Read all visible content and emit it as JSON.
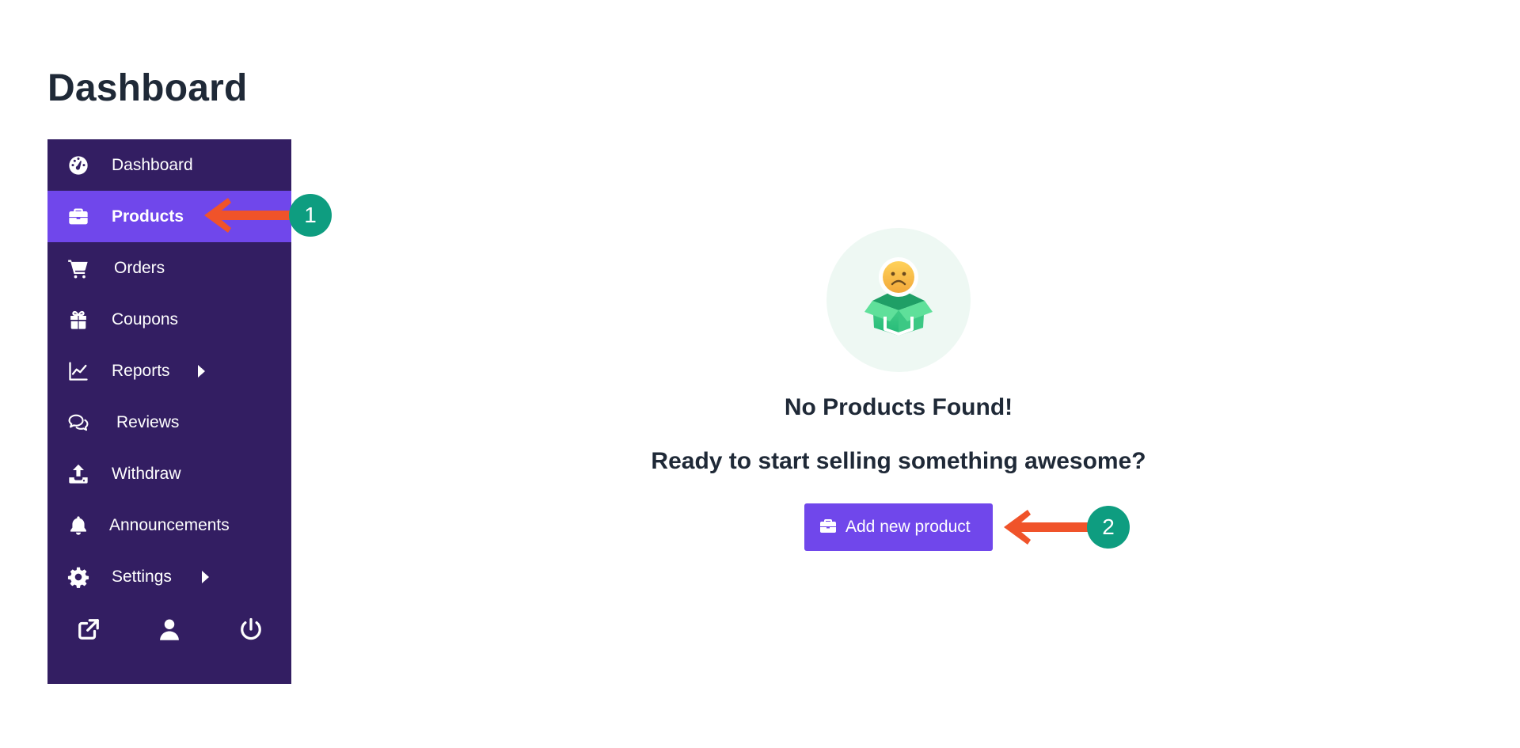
{
  "page": {
    "title": "Dashboard"
  },
  "sidebar": {
    "items": [
      {
        "label": "Dashboard",
        "icon": "tachometer-icon"
      },
      {
        "label": "Products",
        "icon": "briefcase-icon",
        "active": true
      },
      {
        "label": "Orders",
        "icon": "cart-icon"
      },
      {
        "label": "Coupons",
        "icon": "gift-icon"
      },
      {
        "label": "Reports",
        "icon": "line-chart-icon",
        "submenu": true
      },
      {
        "label": "Reviews",
        "icon": "comments-icon"
      },
      {
        "label": "Withdraw",
        "icon": "upload-icon"
      },
      {
        "label": "Announcements",
        "icon": "bell-icon"
      },
      {
        "label": "Settings",
        "icon": "gear-icon",
        "submenu": true
      }
    ],
    "footer": [
      {
        "icon": "external-link-icon"
      },
      {
        "icon": "user-icon"
      },
      {
        "icon": "power-icon"
      }
    ]
  },
  "empty_state": {
    "illustration": "empty-box-sad-face-icon",
    "title": "No Products Found!",
    "subtitle": "Ready to start selling something awesome?",
    "button_label": "Add new product",
    "button_icon": "briefcase-icon"
  },
  "annotations": [
    {
      "label": "1"
    },
    {
      "label": "2"
    }
  ],
  "colors": {
    "sidebar_bg": "#331e62",
    "accent": "#7047eb",
    "callout_arrow": "#f0532a",
    "callout_badge": "#0e9d80",
    "text_dark": "#1f2937"
  }
}
